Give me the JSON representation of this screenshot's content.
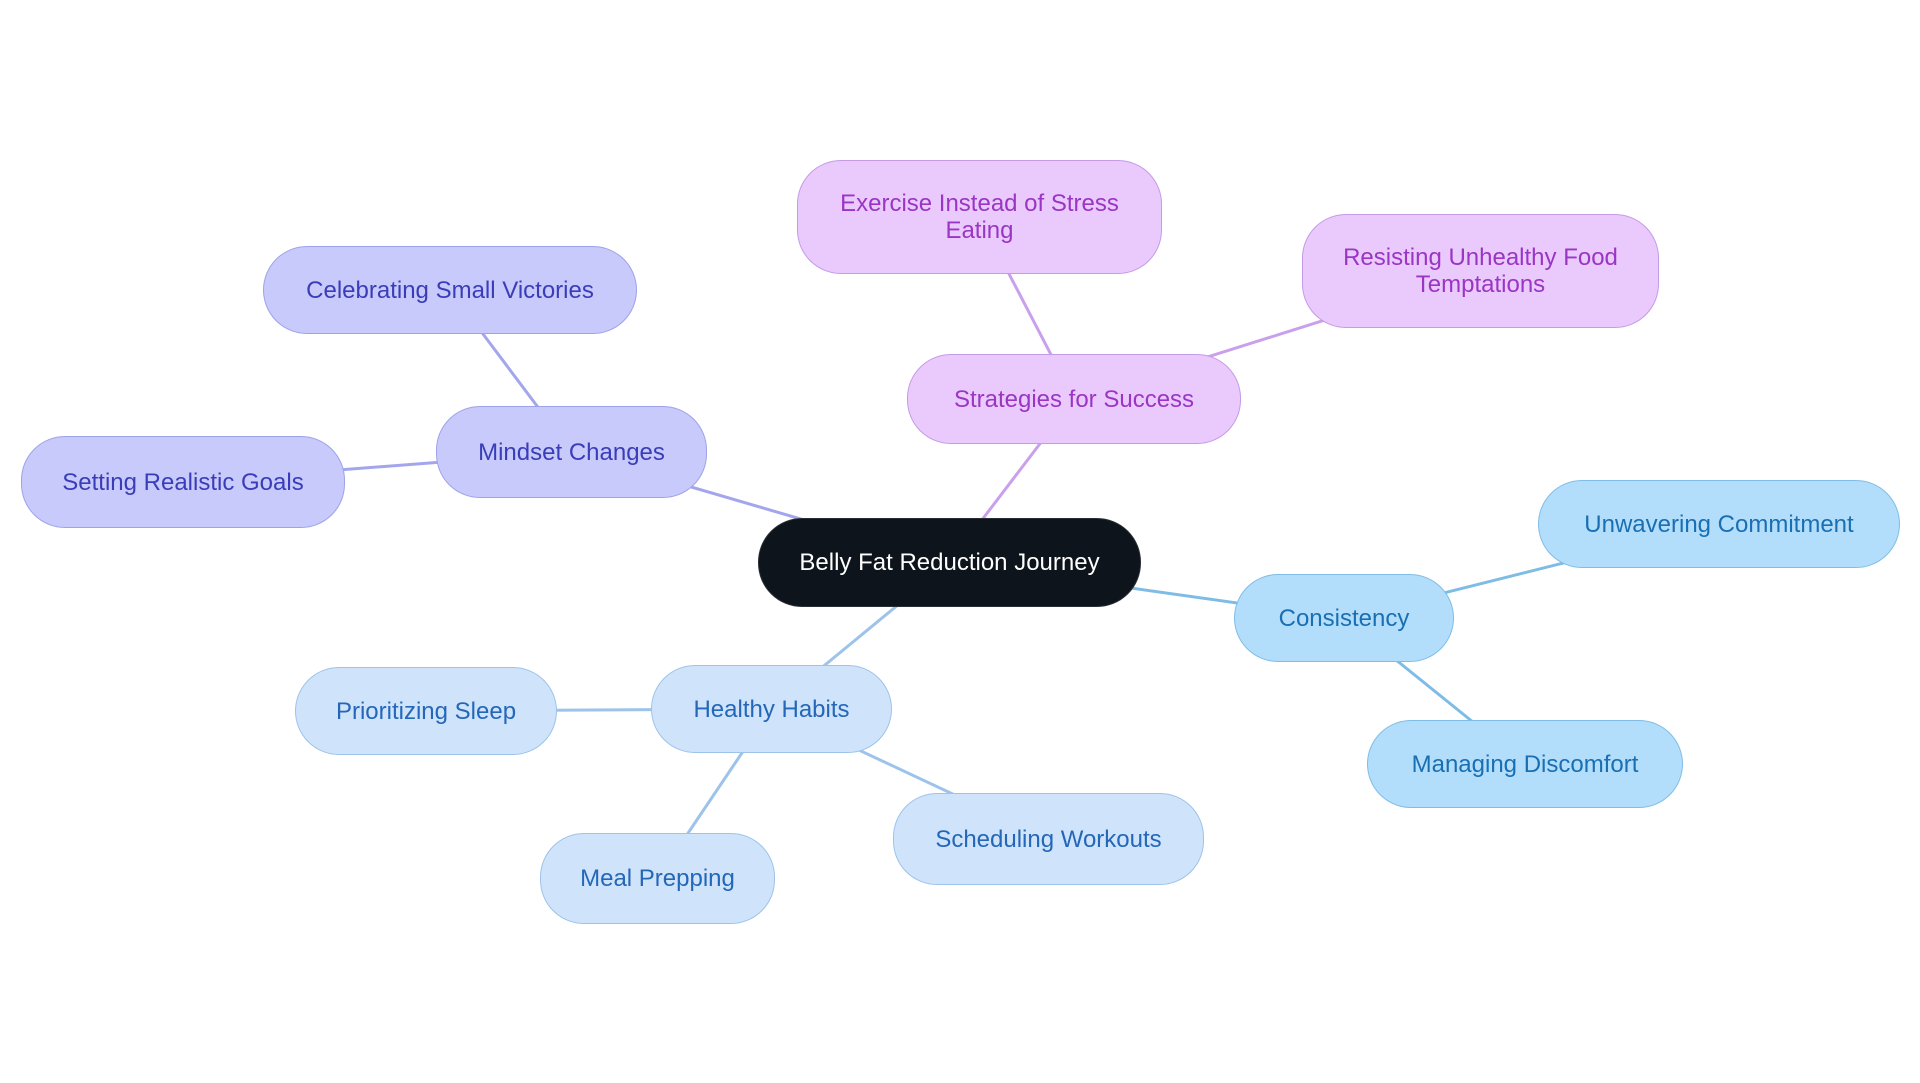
{
  "diagram": {
    "type": "mind-map",
    "root": {
      "id": "root",
      "label": "Belly Fat Reduction Journey"
    },
    "colors": {
      "root_fill": "#0D141B",
      "root_text": "#FFFFFF",
      "purple_fill": "#EACAFD",
      "purple_text": "#9A35C4",
      "purple_edge": "#C9A0EC",
      "indigo_fill": "#C8CAFB",
      "indigo_text": "#3A3DB8",
      "indigo_edge": "#A3A6EC",
      "sky_fill": "#B3DEFB",
      "sky_text": "#1A6FB3",
      "sky_edge": "#7EBCE6",
      "pale_fill": "#CFE4FB",
      "pale_text": "#2467B8",
      "pale_edge": "#9DC3EA"
    },
    "branches": [
      {
        "id": "strategies",
        "label": "Strategies for Success",
        "color": "purple",
        "children": [
          {
            "id": "exercise",
            "label_lines": [
              "Exercise Instead of Stress",
              "Eating"
            ]
          },
          {
            "id": "resisting",
            "label_lines": [
              "Resisting Unhealthy Food",
              "Temptations"
            ]
          }
        ]
      },
      {
        "id": "mindset",
        "label": "Mindset Changes",
        "color": "indigo",
        "children": [
          {
            "id": "celebrating",
            "label": "Celebrating Small Victories"
          },
          {
            "id": "setting",
            "label": "Setting Realistic Goals"
          }
        ]
      },
      {
        "id": "consistency",
        "label": "Consistency",
        "color": "sky",
        "children": [
          {
            "id": "unwavering",
            "label": "Unwavering Commitment"
          },
          {
            "id": "managing",
            "label": "Managing Discomfort"
          }
        ]
      },
      {
        "id": "healthy",
        "label": "Healthy Habits",
        "color": "pale",
        "children": [
          {
            "id": "sleep",
            "label": "Prioritizing Sleep"
          },
          {
            "id": "meal",
            "label": "Meal Prepping"
          },
          {
            "id": "scheduling",
            "label": "Scheduling Workouts"
          }
        ]
      }
    ],
    "edges": [
      {
        "from": "root",
        "to": "strategies",
        "color": "purple"
      },
      {
        "from": "strategies",
        "to": "exercise",
        "color": "purple"
      },
      {
        "from": "strategies",
        "to": "resisting",
        "color": "purple"
      },
      {
        "from": "root",
        "to": "mindset",
        "color": "indigo"
      },
      {
        "from": "mindset",
        "to": "celebrating",
        "color": "indigo"
      },
      {
        "from": "mindset",
        "to": "setting",
        "color": "indigo"
      },
      {
        "from": "root",
        "to": "consistency",
        "color": "sky"
      },
      {
        "from": "consistency",
        "to": "unwavering",
        "color": "sky"
      },
      {
        "from": "consistency",
        "to": "managing",
        "color": "sky"
      },
      {
        "from": "root",
        "to": "healthy",
        "color": "pale"
      },
      {
        "from": "healthy",
        "to": "sleep",
        "color": "pale"
      },
      {
        "from": "healthy",
        "to": "meal",
        "color": "pale"
      },
      {
        "from": "healthy",
        "to": "scheduling",
        "color": "pale"
      }
    ]
  }
}
